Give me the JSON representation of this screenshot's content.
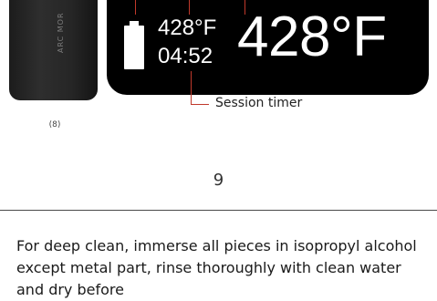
{
  "figure": {
    "device_label_1": "ARC MOR",
    "device_label_2": "—",
    "photo_caption": "(8)",
    "display": {
      "small_temperature": "428°F",
      "session_time": "04:52",
      "large_temperature": "428°F"
    },
    "callout_session_timer": "Session timer"
  },
  "page_number": "9",
  "instructions": {
    "paragraph": "For deep clean, immerse all pieces in isopropyl alcohol except metal part, rinse thoroughly with clean water and dry before"
  },
  "colors": {
    "display_bg": "#000000",
    "callout_line": "#c0392b",
    "display_text": "#ffffff"
  }
}
